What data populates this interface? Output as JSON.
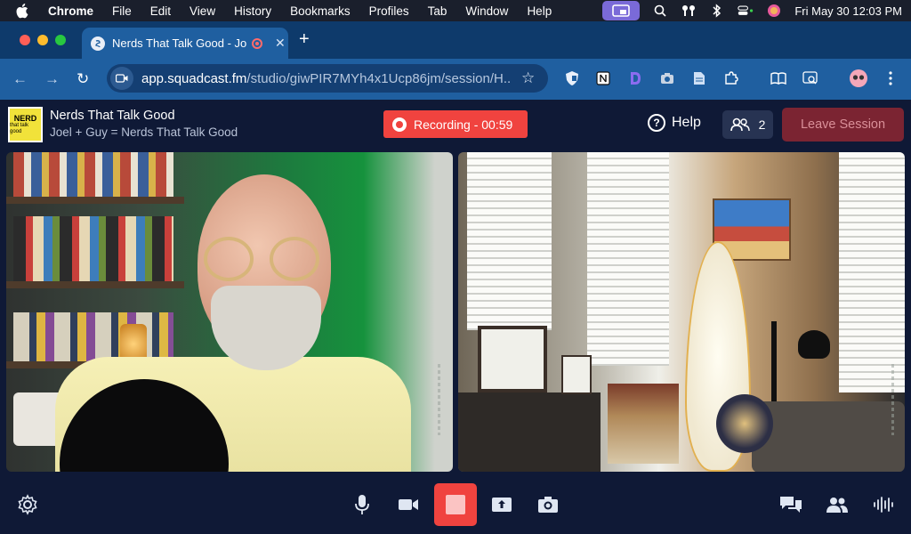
{
  "menubar": {
    "app": "Chrome",
    "items": [
      "File",
      "Edit",
      "View",
      "History",
      "Bookmarks",
      "Profiles",
      "Tab",
      "Window",
      "Help"
    ],
    "clock": "Fri May 30  12:03 PM"
  },
  "browser": {
    "tab_title": "Nerds That Talk Good - Jo",
    "url_host": "app.squadcast.fm",
    "url_path": "/studio/giwPIR7MYh4x1Ucp86jm/session/H..."
  },
  "app": {
    "show_title": "Nerds That Talk Good",
    "show_subtitle": "Joel + Guy = Nerds That Talk Good",
    "logo_line1": "NERD",
    "logo_line2": "that talk good",
    "recording_label": "Recording - 00:59",
    "help_label": "Help",
    "participants_count": "2",
    "leave_label": "Leave Session"
  },
  "icons": {
    "accent_red": "#f0433f",
    "header_bg": "#0f1936",
    "browser_blue": "#1f5fa0"
  }
}
